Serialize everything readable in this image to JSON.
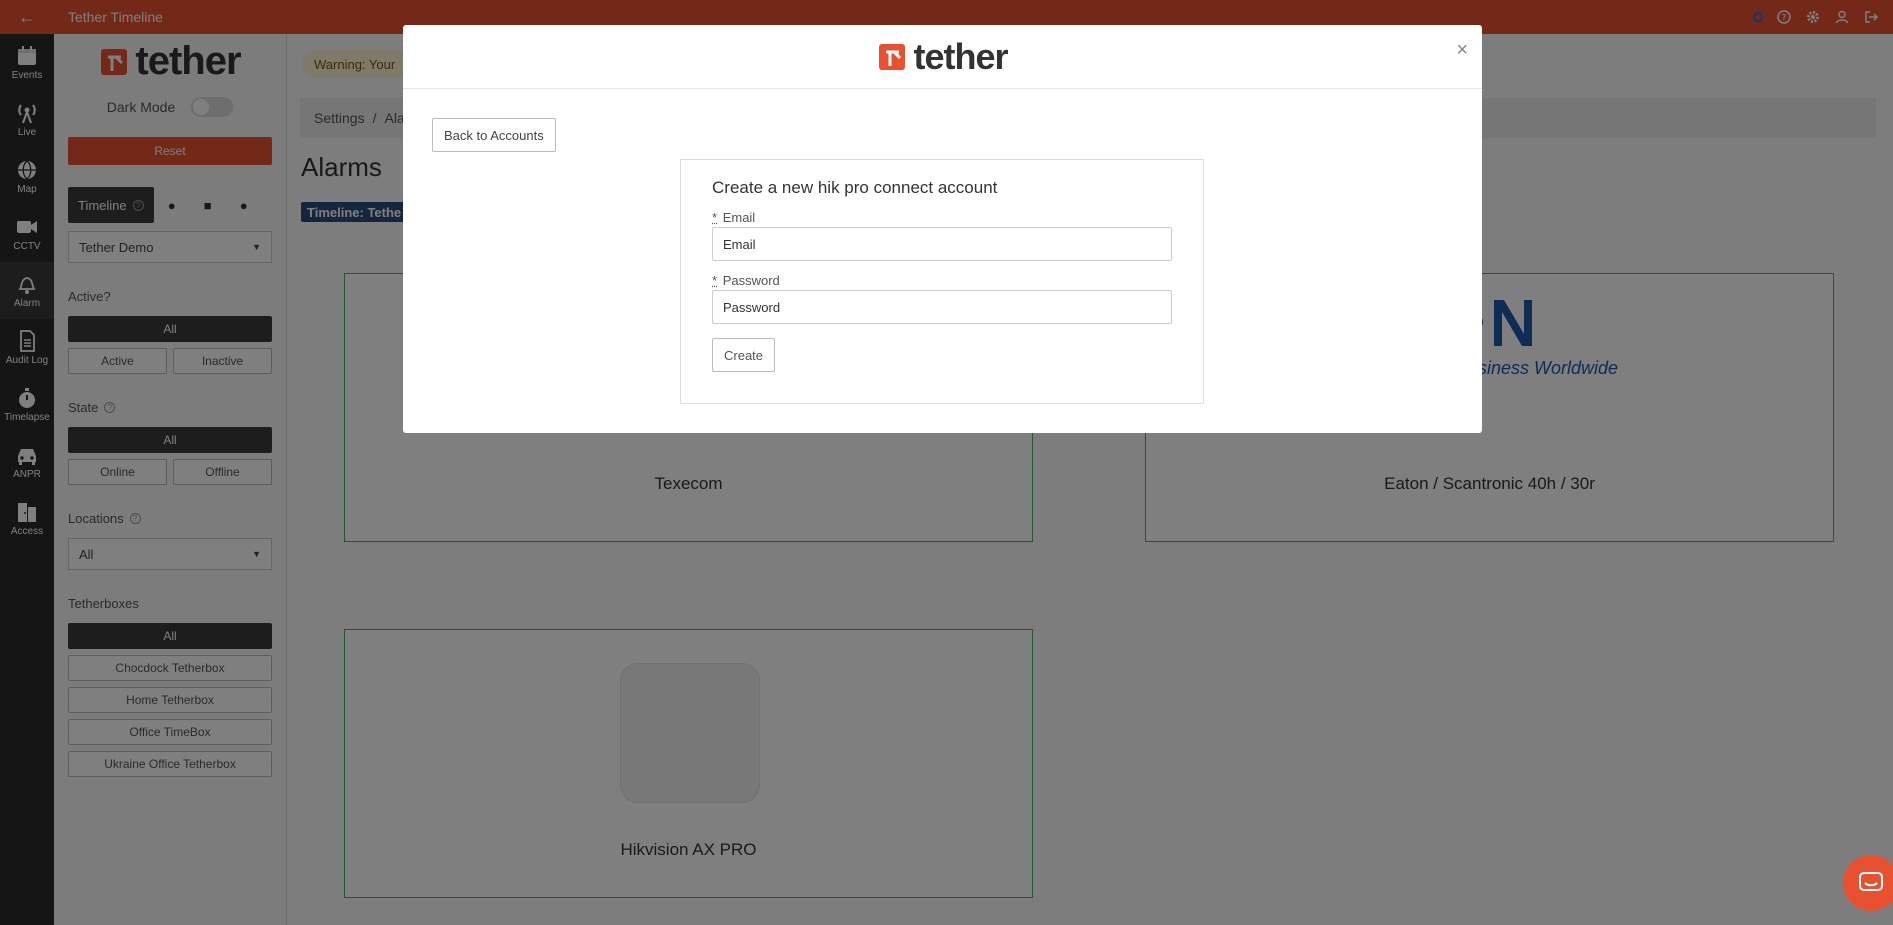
{
  "window": {
    "title": "Tether Timeline"
  },
  "colors": {
    "brand": "#e8512f",
    "rail": "#2b2b2b",
    "card_border": "#4caf50"
  },
  "rail": [
    {
      "label": "Events",
      "icon": "calendar-icon"
    },
    {
      "label": "Live",
      "icon": "broadcast-icon"
    },
    {
      "label": "Map",
      "icon": "globe-icon"
    },
    {
      "label": "CCTV",
      "icon": "video-camera-icon"
    },
    {
      "label": "Alarm",
      "icon": "bell-icon"
    },
    {
      "label": "Audit Log",
      "icon": "document-icon"
    },
    {
      "label": "Timelapse",
      "icon": "stopwatch-icon"
    },
    {
      "label": "ANPR",
      "icon": "car-icon"
    },
    {
      "label": "Access",
      "icon": "door-icon"
    }
  ],
  "sidebar": {
    "logo_text": "tether",
    "dark_mode_label": "Dark Mode",
    "reset_label": "Reset",
    "timeline_tab": "Timeline",
    "site_select": "Tether Demo",
    "active_label": "Active?",
    "active_all": "All",
    "active_options": [
      "Active",
      "Inactive"
    ],
    "state_label": "State",
    "state_all": "All",
    "state_options": [
      "Online",
      "Offline"
    ],
    "locations_label": "Locations",
    "locations_select": "All",
    "tetherboxes_label": "Tetherboxes",
    "tetherboxes_all": "All",
    "tetherboxes": [
      "Chocdock Tetherbox",
      "Home Tetherbox",
      "Office TimeBox",
      "Ukraine Office Tetherbox"
    ]
  },
  "main": {
    "warning": "Warning: Your",
    "breadcrumb": [
      "Settings",
      "/",
      "Ala"
    ],
    "page_title": "Alarms",
    "timeline_badge": "Timeline: Tethe",
    "cards": [
      {
        "label": "Texecom"
      },
      {
        "label": "Eaton / Scantronic 40h / 30r",
        "logo_text": "Business Worldwide"
      },
      {
        "label": "Hikvision AX PRO"
      }
    ]
  },
  "modal": {
    "logo_text": "tether",
    "close": "×",
    "back_label": "Back to Accounts",
    "form_title": "Create a new hik pro connect account",
    "required_mark": "*",
    "email_label": "Email",
    "email_placeholder": "Email",
    "password_label": "Password",
    "password_placeholder": "Password",
    "create_label": "Create"
  }
}
